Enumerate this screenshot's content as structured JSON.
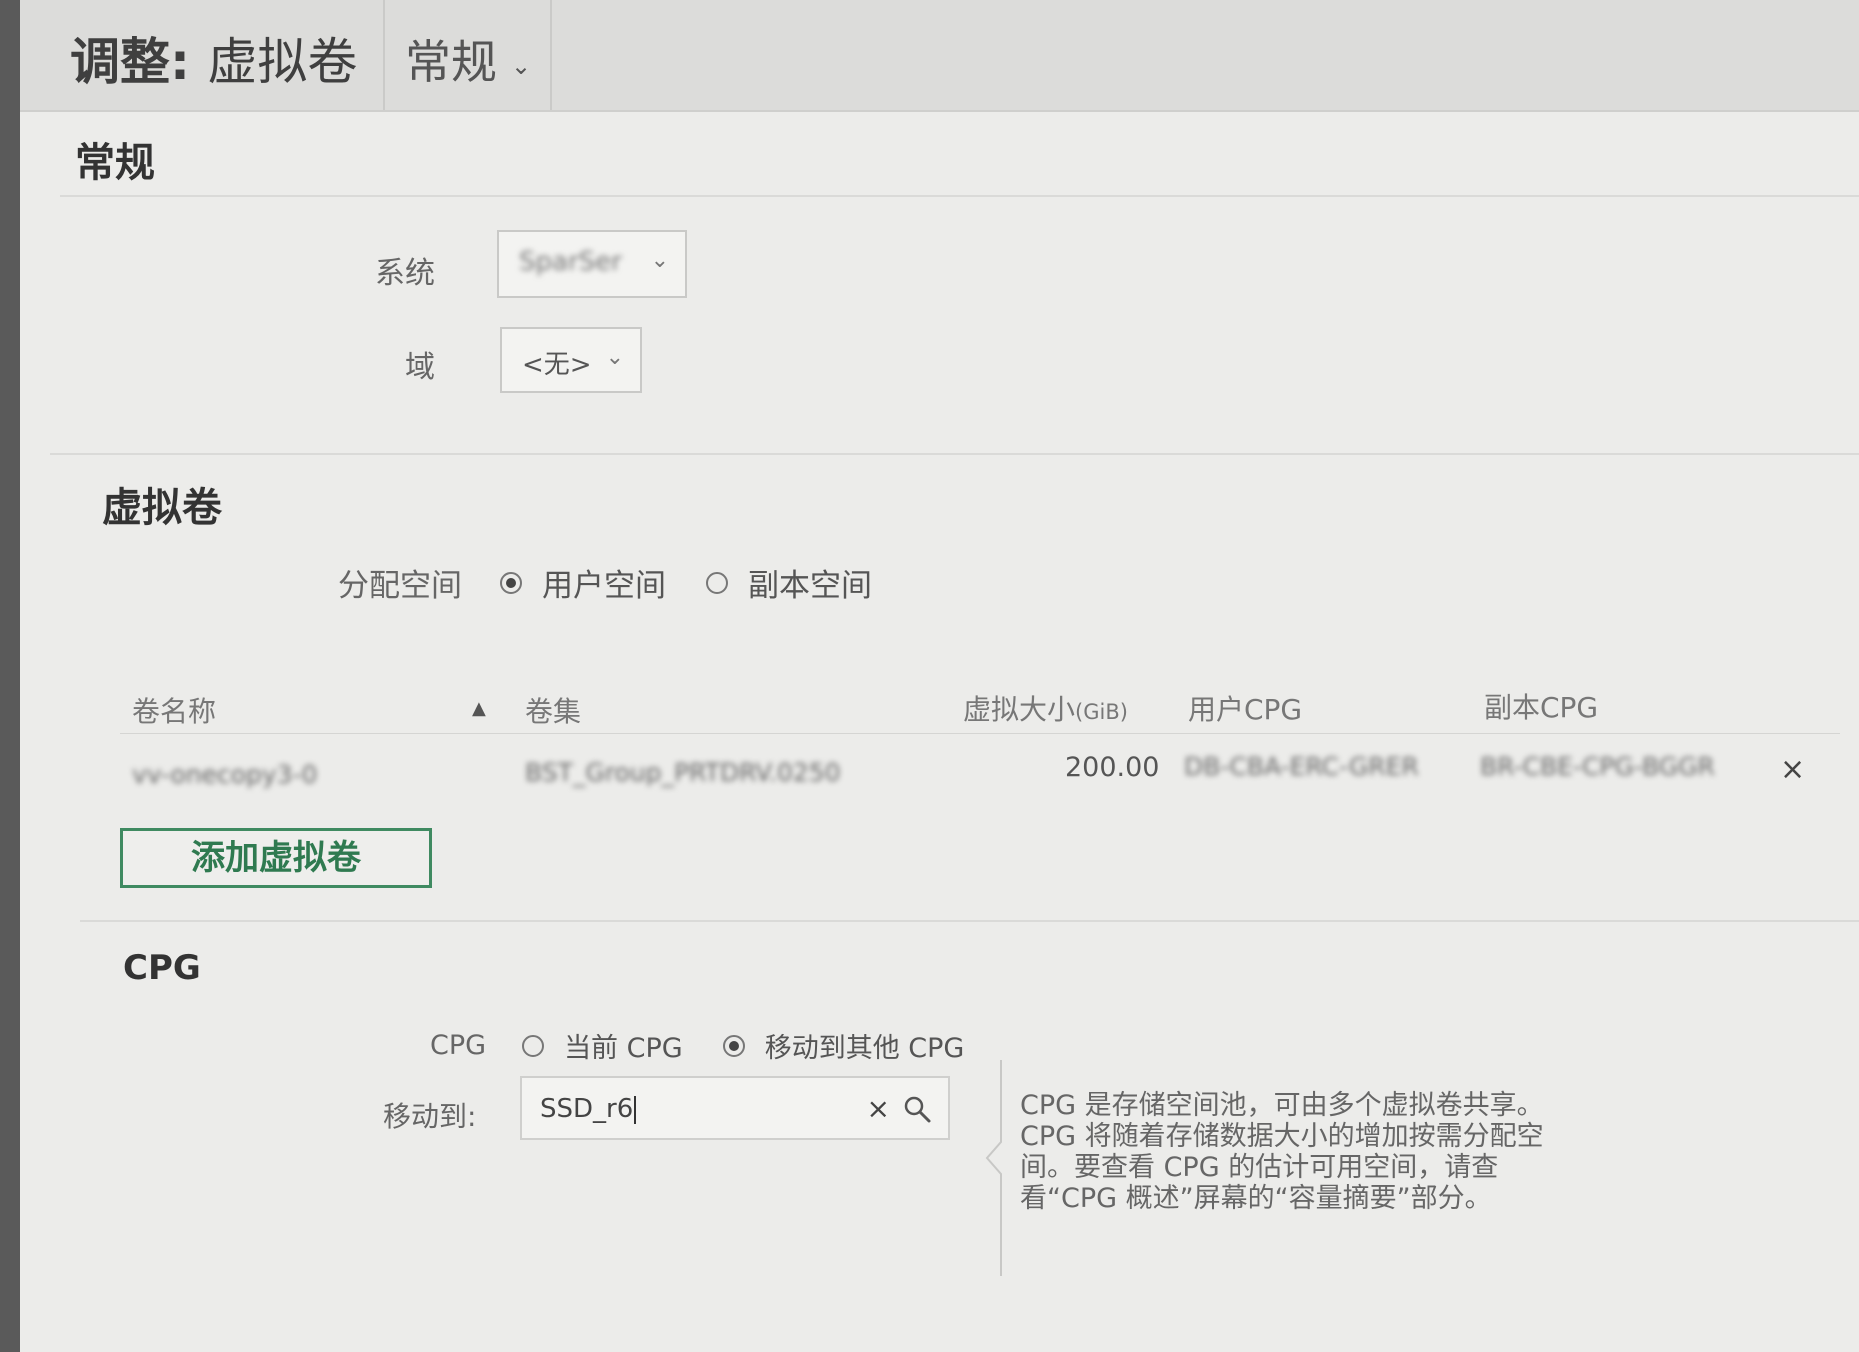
{
  "header": {
    "title_prefix": "调整:",
    "title_object": "虚拟卷",
    "view_select": "常规"
  },
  "general": {
    "section_title": "常规",
    "system_label": "系统",
    "system_value": "SparSer",
    "domain_label": "域",
    "domain_value": "<无>"
  },
  "virtual_volumes": {
    "section_title": "虚拟卷",
    "allocate_label": "分配空间",
    "options": [
      {
        "label": "用户空间",
        "checked": true
      },
      {
        "label": "副本空间",
        "checked": false
      }
    ],
    "columns": {
      "name": "卷名称",
      "set": "卷集",
      "size": "虚拟大小",
      "size_unit": "(GiB)",
      "user_cpg": "用户CPG",
      "copy_cpg": "副本CPG"
    },
    "rows": [
      {
        "name": "vv-onecopy3-0",
        "set": "BST_Group_PRTDRV.0250",
        "size": "200.00",
        "user_cpg": "DB-CBA-ERC-GRER",
        "copy_cpg": "BR-CBE-CPG-BGGR"
      }
    ],
    "add_button": "添加虚拟卷",
    "remove_icon": "×"
  },
  "cpg": {
    "section_title": "CPG",
    "cpg_label": "CPG",
    "options": [
      {
        "label": "当前 CPG",
        "checked": false
      },
      {
        "label": "移动到其他 CPG",
        "checked": true
      }
    ],
    "move_to_label": "移动到:",
    "move_to_value": "SSD_r6",
    "clear_icon": "×",
    "help_text": "CPG 是存储空间池，可由多个虚拟卷共享。CPG 将随着存储数据大小的增加按需分配空间。要查看 CPG 的估计可用空间，请查看“CPG 概述”屏幕的“容量摘要”部分。"
  }
}
